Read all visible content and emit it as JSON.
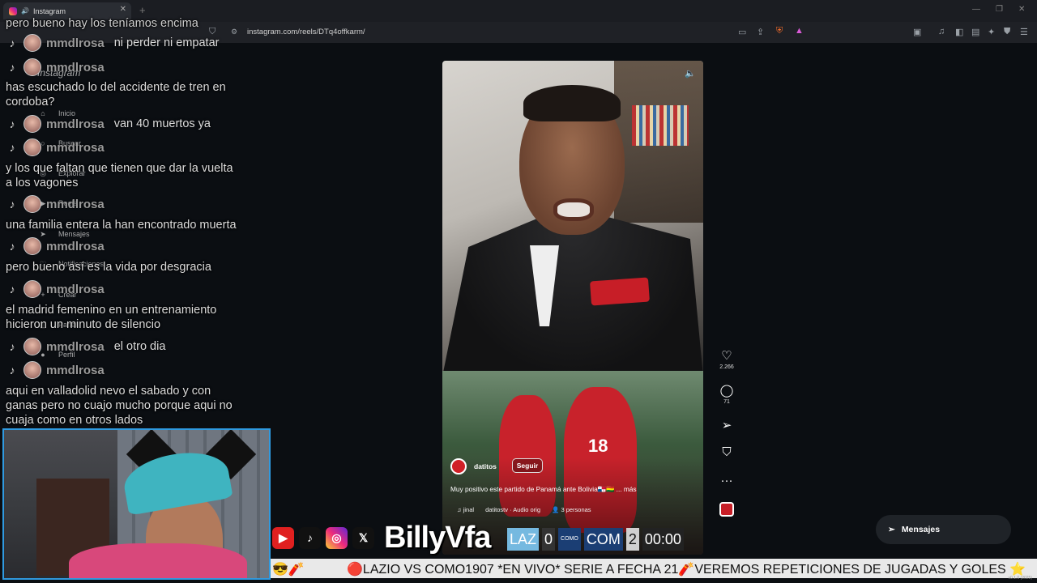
{
  "browser": {
    "tab_title": "Instagram",
    "url": "instagram.com/reels/DTq4offkarm/",
    "new_tab_glyph": "+",
    "close_glyph": "✕",
    "win_controls": [
      "—",
      "❐",
      "✕"
    ]
  },
  "ig_nav": {
    "brand": "Instagram",
    "items": [
      {
        "label": "Inicio",
        "icon": "home-icon"
      },
      {
        "label": "Buscar",
        "icon": "search-icon"
      },
      {
        "label": "Explorar",
        "icon": "compass-icon"
      },
      {
        "label": "Reels",
        "icon": "reels-icon"
      },
      {
        "label": "Mensajes",
        "icon": "send-icon"
      },
      {
        "label": "Notificaciones",
        "icon": "heart-icon"
      },
      {
        "label": "Crear",
        "icon": "plus-icon"
      },
      {
        "label": "Panel",
        "icon": "chart-icon"
      },
      {
        "label": "Perfil",
        "icon": "avatar-icon"
      }
    ]
  },
  "chat": {
    "top_cut": "pero bueno hay los teníamos encima",
    "rows": [
      {
        "user": "mmdlrosa",
        "msg": "ni perder ni empatar"
      },
      {
        "user": "mmdlrosa",
        "msg": ""
      },
      {
        "text": "has escuchado lo del accidente de tren en"
      },
      {
        "text": "cordoba?"
      },
      {
        "user": "mmdlrosa",
        "msg": "van 40 muertos ya"
      },
      {
        "user": "mmdlrosa",
        "msg": ""
      },
      {
        "text": "y los que faltan que tienen que dar la vuelta"
      },
      {
        "text": "a los vagones"
      },
      {
        "user": "mmdlrosa",
        "msg": ""
      },
      {
        "text": "una familia entera la han encontrado muerta"
      },
      {
        "user": "mmdlrosa",
        "msg": ""
      },
      {
        "text": "pero bueno así es la vida por desgracia"
      },
      {
        "user": "mmdlrosa",
        "msg": ""
      },
      {
        "text": "el madrid femenino en un entrenamiento"
      },
      {
        "text": "hicieron un minuto de silencio"
      },
      {
        "user": "mmdlrosa",
        "msg": "el otro dia"
      },
      {
        "user": "mmdlrosa",
        "msg": ""
      },
      {
        "text": "aqui en valladolid nevo el sabado y con"
      },
      {
        "text": "ganas pero no cuajo mucho porque aqui no"
      },
      {
        "text": "cuaja como en otros lados"
      }
    ]
  },
  "reel": {
    "account": "datitos",
    "follow_label": "Seguir",
    "caption": "Muy positivo este partido de Panamá ante Bolivia🇵🇦🇧🇴 ... más",
    "audio_left": "♫ jinal",
    "audio_mid": "datitostv · Audio orig",
    "audio_people": "👤 3 personas",
    "shirt_number": "18",
    "likes": "2.266",
    "comments": "71"
  },
  "messages_button": "Mensajes",
  "stream": {
    "brand": "BillyVfa",
    "score": {
      "home": "LAZ",
      "home_score": "0",
      "away_crest": "COMO",
      "away": "COM",
      "away_score": "2",
      "clock": "00:00"
    },
    "ticker": "🔴LAZIO VS COMO1907 *EN VIVO* SERIE A FECHA 21🧨VEREMOS REPETICIONES DE JUGADAS Y GOLES ⭐",
    "ticker_prefix": "😎🧨",
    "version": "v0.1.0 (2025)"
  },
  "colors": {
    "accent": "#2f9ae0",
    "lazio": "#75b9e0",
    "como": "#1b3e74",
    "youtube": "#e02020",
    "instagram": "#d6297c"
  }
}
